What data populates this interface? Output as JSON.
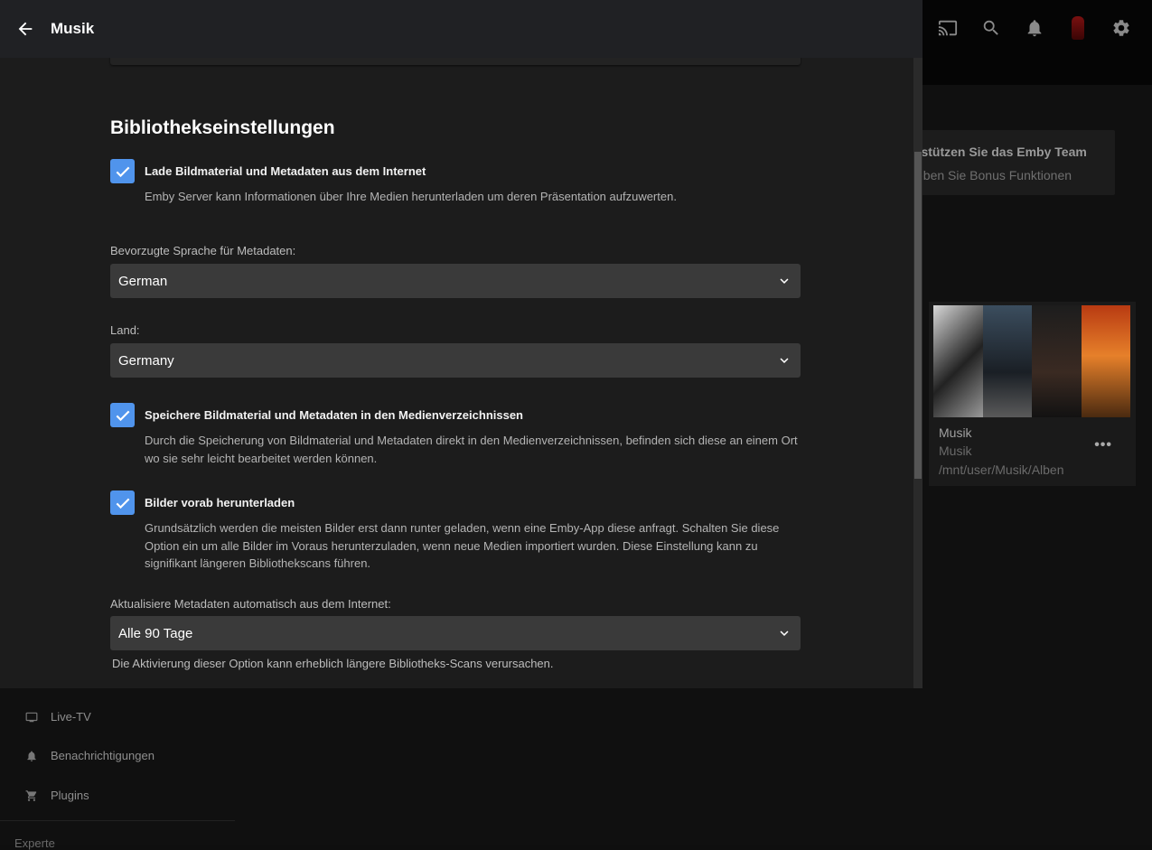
{
  "dialog": {
    "title": "Musik",
    "section_title": "Bibliothekseinstellungen",
    "options": [
      {
        "label": "Lade Bildmaterial und Metadaten aus dem Internet",
        "description": "Emby Server kann Informationen über Ihre Medien herunterladen um deren Präsentation aufzuwerten.",
        "checked": true
      },
      {
        "label": "Speichere Bildmaterial und Metadaten in den Medienverzeichnissen",
        "description": "Durch die Speicherung von Bildmaterial und Metadaten direkt in den Medienverzeichnissen, befinden sich diese an einem Ort wo sie sehr leicht bearbeitet werden können.",
        "checked": true
      },
      {
        "label": "Bilder vorab herunterladen",
        "description": "Grundsätzlich werden die meisten Bilder erst dann runter geladen, wenn eine Emby-App diese anfragt. Schalten Sie diese Option ein um alle Bilder im Voraus herunterzuladen, wenn neue Medien importiert wurden. Diese Einstellung kann zu signifikant längeren Bibliothekscans führen.",
        "checked": true
      }
    ],
    "language": {
      "label": "Bevorzugte Sprache für Metadaten:",
      "value": "German"
    },
    "country": {
      "label": "Land:",
      "value": "Germany"
    },
    "refresh": {
      "label": "Aktualisiere Metadaten automatisch aus dem Internet:",
      "value": "Alle 90 Tage",
      "help": "Die Aktivierung dieser Option kann erheblich längere Bibliotheks-Scans verursachen."
    }
  },
  "background": {
    "topbar_icons": [
      "cast-icon",
      "search-icon",
      "bell-icon",
      "user-avatar",
      "gear-icon"
    ],
    "support_card": {
      "title": "rstützen Sie das Emby Team",
      "subtitle": "eben Sie Bonus Funktionen"
    },
    "library_card": {
      "name": "Musik",
      "type": "Musik",
      "path": "/mnt/user/Musik/Alben",
      "more": "•••"
    },
    "nav": [
      {
        "label": "Live-TV",
        "icon": "tv-icon"
      },
      {
        "label": "Benachrichtigungen",
        "icon": "bell-icon"
      },
      {
        "label": "Plugins",
        "icon": "cart-icon"
      }
    ],
    "nav_section": "Experte"
  },
  "colors": {
    "accent": "#5094ec",
    "dialog_bg": "#1c1c1c",
    "header_bg": "#202124",
    "select_bg": "#3a3a3a"
  }
}
